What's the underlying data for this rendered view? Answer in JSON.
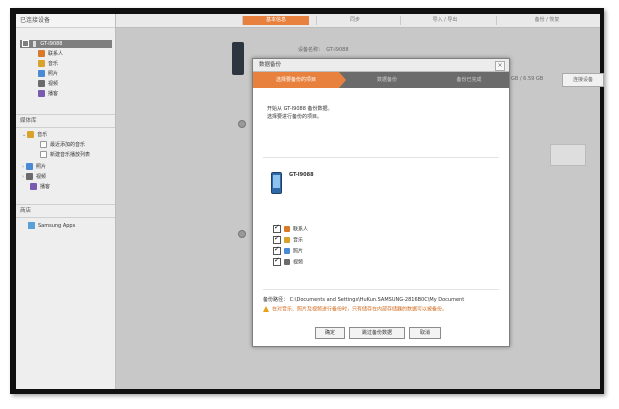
{
  "sidebar": {
    "connected_header": "已连接设备",
    "device_name": "GT-I9088",
    "device_items": [
      {
        "label": "联系人",
        "icon": "contacts-icon",
        "color": "#d97a2b"
      },
      {
        "label": "音乐",
        "icon": "music-icon",
        "color": "#d9a22b"
      },
      {
        "label": "照片",
        "icon": "photo-icon",
        "color": "#4a8ad4"
      },
      {
        "label": "视频",
        "icon": "video-icon",
        "color": "#6b6b6b"
      },
      {
        "label": "播客",
        "icon": "podcast-icon",
        "color": "#7a5ab0"
      }
    ],
    "library_header": "媒体库",
    "library_music": "音乐",
    "library_music_sub": [
      "最近添加的音乐",
      "新建音乐播放列表"
    ],
    "library_items": [
      "照片",
      "视频",
      "播客"
    ],
    "store_header": "商店",
    "store_item": "Samsung Apps"
  },
  "topbar": {
    "tabs": [
      "基本信息",
      "同步",
      "导入 / 导出",
      "备份 / 恢复"
    ],
    "active_tab": 0
  },
  "main": {
    "device_name_label": "设备名称：",
    "device_name_value": "GT-I9088",
    "storage_text": "GB / 6.59 GB",
    "side_button": "连接设备"
  },
  "dialog": {
    "title": "数据备份",
    "close": "×",
    "steps": [
      "选择要备份的项目",
      "数据备份",
      "备份已完成"
    ],
    "active_step": 0,
    "intro_line1": "开始从 GT-I9088 备份数据。",
    "intro_line2": "选择要进行备份的项目。",
    "device_label": "GT-I9088",
    "items": [
      {
        "label": "联系人",
        "icon": "contacts-icon",
        "color": "#d97a2b",
        "checked": true
      },
      {
        "label": "音乐",
        "icon": "music-icon",
        "color": "#d9a22b",
        "checked": true
      },
      {
        "label": "照片",
        "icon": "photo-icon",
        "color": "#4a8ad4",
        "checked": true
      },
      {
        "label": "视频",
        "icon": "video-icon",
        "color": "#6b6b6b",
        "checked": true
      }
    ],
    "path_label": "备份路径：",
    "path_value": "C:\\Documents and Settings\\HuKun.SAMSUNG-2816B0C\\My Document",
    "warning": "在对音乐、照片及视频进行备份时，只有储存在内部存储器的数据可以被备份。",
    "buttons": {
      "confirm": "确定",
      "skip": "跳过备份数据",
      "cancel": "取消"
    }
  },
  "colors": {
    "accent": "#e8813d",
    "steps_bg": "#6b6b6b",
    "warning": "#d06a1d"
  }
}
